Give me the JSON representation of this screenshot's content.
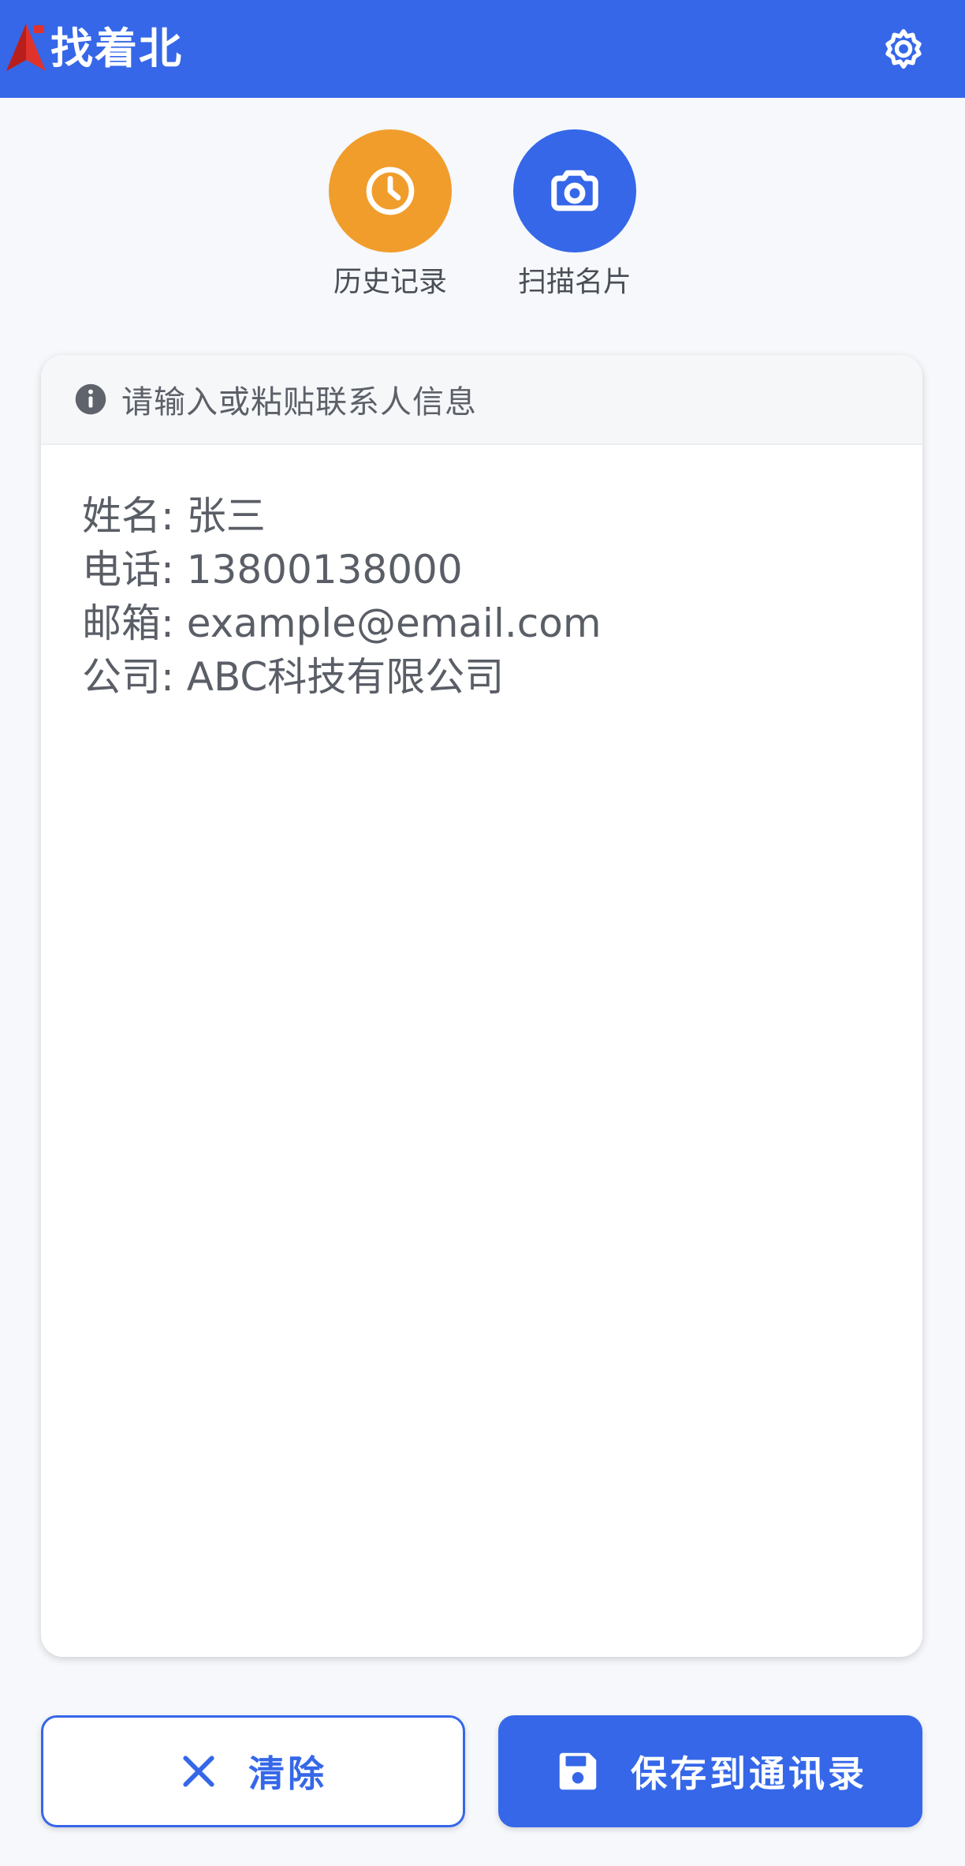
{
  "header": {
    "title": "找着北",
    "logo_icon": "red-arrow-logo",
    "settings_icon": "gear-icon"
  },
  "quick_actions": [
    {
      "label": "历史记录",
      "icon": "clock-icon",
      "color": "#f19d2c"
    },
    {
      "label": "扫描名片",
      "icon": "camera-icon",
      "color": "#3567e8"
    }
  ],
  "card": {
    "header_text": "请输入或粘贴联系人信息",
    "header_icon": "info-icon",
    "input_value": "姓名: 张三\n电话: 13800138000\n邮箱: example@email.com\n公司: ABC科技有限公司"
  },
  "buttons": {
    "clear_label": "清除",
    "clear_icon": "close-icon",
    "save_label": "保存到通讯录",
    "save_icon": "floppy-disk-icon"
  },
  "colors": {
    "primary": "#3567e8",
    "accent": "#f19d2c",
    "background": "#f6f8fb"
  }
}
